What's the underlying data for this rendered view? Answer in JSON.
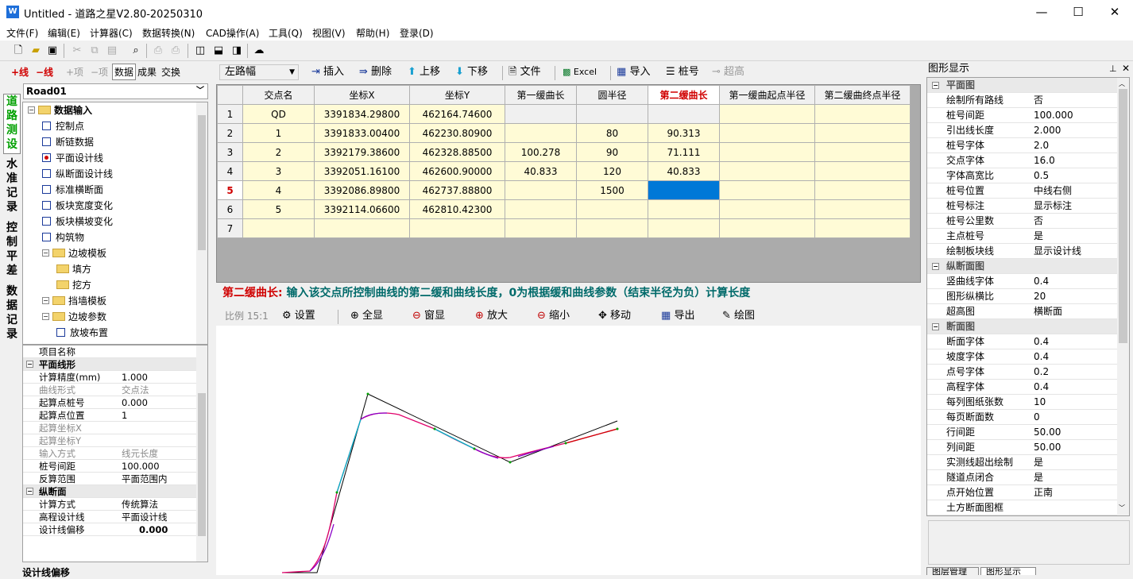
{
  "window": {
    "title": "Untitled - 道路之星V2.80-20250310",
    "icon": "app-icon",
    "minimize": "—",
    "maximize": "☐",
    "close": "✕"
  },
  "menu": [
    "文件(F)",
    "编辑(E)",
    "计算器(C)",
    "数据转换(N)",
    "CAD操作(A)",
    "工具(Q)",
    "视图(V)",
    "帮助(H)",
    "登录(D)"
  ],
  "left": {
    "buttons": {
      "add_line": "+线",
      "del_line": "−线",
      "add_item": "+项",
      "del_item": "−项",
      "data": "数据",
      "result": "成果",
      "exchange": "交换"
    },
    "road": "Road01",
    "vtabs": [
      "道路测设",
      "水准记录",
      "控制平差",
      "数据记录"
    ],
    "tree": [
      {
        "label": "数据输入",
        "kind": "folder",
        "level": 0
      },
      {
        "label": "控制点",
        "kind": "check",
        "level": 1
      },
      {
        "label": "断链数据",
        "kind": "check",
        "level": 1
      },
      {
        "label": "平面设计线",
        "kind": "checkon",
        "level": 1
      },
      {
        "label": "纵断面设计线",
        "kind": "check",
        "level": 1
      },
      {
        "label": "标准横断面",
        "kind": "check",
        "level": 1
      },
      {
        "label": "板块宽度变化",
        "kind": "check",
        "level": 1
      },
      {
        "label": "板块横坡变化",
        "kind": "check",
        "level": 1
      },
      {
        "label": "构筑物",
        "kind": "check",
        "level": 1
      },
      {
        "label": "边坡模板",
        "kind": "folder",
        "level": 1
      },
      {
        "label": "填方",
        "kind": "folder",
        "level": 2
      },
      {
        "label": "挖方",
        "kind": "folder",
        "level": 2
      },
      {
        "label": "挡墙模板",
        "kind": "folder",
        "level": 1
      },
      {
        "label": "边坡参数",
        "kind": "folder",
        "level": 1
      },
      {
        "label": "放坡布置",
        "kind": "check",
        "level": 2
      }
    ],
    "props": [
      {
        "k": "项目名称",
        "v": "",
        "t": "row"
      },
      {
        "k": "平面线形",
        "v": "",
        "t": "cat"
      },
      {
        "k": "计算精度(mm)",
        "v": "1.000",
        "t": "row"
      },
      {
        "k": "曲线形式",
        "v": "交点法",
        "t": "dis"
      },
      {
        "k": "起算点桩号",
        "v": "0.000",
        "t": "row"
      },
      {
        "k": "起算点位置",
        "v": "1",
        "t": "row"
      },
      {
        "k": "起算坐标X",
        "v": "",
        "t": "dis"
      },
      {
        "k": "起算坐标Y",
        "v": "",
        "t": "dis"
      },
      {
        "k": "输入方式",
        "v": "线元长度",
        "t": "dis"
      },
      {
        "k": "桩号间距",
        "v": "100.000",
        "t": "row"
      },
      {
        "k": "反算范围",
        "v": "平面范围内",
        "t": "row"
      },
      {
        "k": "纵断面",
        "v": "",
        "t": "cat"
      },
      {
        "k": "计算方式",
        "v": "传统算法",
        "t": "row"
      },
      {
        "k": "高程设计线",
        "v": "平面设计线",
        "t": "row"
      },
      {
        "k": "设计线偏移",
        "v": "0.000",
        "t": "bold"
      }
    ],
    "bottom_label": "设计线偏移"
  },
  "center": {
    "side_select": "左路幅",
    "toolbar": [
      "插入",
      "删除",
      "上移",
      "下移",
      "文件",
      "Excel",
      "导入",
      "桩号",
      "超高"
    ],
    "columns": [
      "交点名",
      "坐标X",
      "坐标Y",
      "第一缓曲长",
      "圆半径",
      "第二缓曲长",
      "第一缓曲起点半径",
      "第二缓曲终点半径"
    ],
    "rows": [
      {
        "n": "1",
        "cells": [
          "QD",
          "3391834.29800",
          "462164.74600",
          "",
          "",
          "",
          "",
          ""
        ]
      },
      {
        "n": "2",
        "cells": [
          "1",
          "3391833.00400",
          "462230.80900",
          "",
          "80",
          "90.313",
          "",
          ""
        ]
      },
      {
        "n": "3",
        "cells": [
          "2",
          "3392179.38600",
          "462328.88500",
          "100.278",
          "90",
          "71.111",
          "",
          ""
        ]
      },
      {
        "n": "4",
        "cells": [
          "3",
          "3392051.16100",
          "462600.90000",
          "40.833",
          "120",
          "40.833",
          "",
          ""
        ]
      },
      {
        "n": "5",
        "cells": [
          "4",
          "3392086.89800",
          "462737.88800",
          "",
          "1500",
          "",
          "",
          ""
        ]
      },
      {
        "n": "6",
        "cells": [
          "5",
          "3392114.06600",
          "462810.42300",
          "",
          "",
          "",
          "",
          ""
        ]
      },
      {
        "n": "7",
        "cells": [
          "",
          "",
          "",
          "",
          "",
          "",
          "",
          ""
        ]
      }
    ],
    "hint_key": "第二缓曲长:",
    "hint_text": " 输入该交点所控制曲线的第二缓和曲线长度，0为根据缓和曲线参数（结束半径为负）计算长度",
    "draw_toolbar": {
      "scale": "比例 15:1",
      "items": [
        "设置",
        "全显",
        "窗显",
        "放大",
        "缩小",
        "移动",
        "导出",
        "绘图"
      ]
    }
  },
  "right": {
    "title": "图形显示",
    "rows": [
      {
        "k": "平面图",
        "v": "",
        "t": "cat"
      },
      {
        "k": "绘制所有路线",
        "v": "否"
      },
      {
        "k": "桩号间距",
        "v": "100.000"
      },
      {
        "k": "引出线长度",
        "v": "2.000"
      },
      {
        "k": "桩号字体",
        "v": "2.0"
      },
      {
        "k": "交点字体",
        "v": "16.0"
      },
      {
        "k": "字体高宽比",
        "v": "0.5"
      },
      {
        "k": "桩号位置",
        "v": "中线右侧"
      },
      {
        "k": "桩号标注",
        "v": "显示标注"
      },
      {
        "k": "桩号公里数",
        "v": "否"
      },
      {
        "k": "主点桩号",
        "v": "是"
      },
      {
        "k": "绘制板块线",
        "v": "显示设计线"
      },
      {
        "k": "纵断面图",
        "v": "",
        "t": "cat"
      },
      {
        "k": "竖曲线字体",
        "v": "0.4"
      },
      {
        "k": "图形纵横比",
        "v": "20"
      },
      {
        "k": "超高图",
        "v": "横断面"
      },
      {
        "k": "断面图",
        "v": "",
        "t": "cat"
      },
      {
        "k": "断面字体",
        "v": "0.4"
      },
      {
        "k": "坡度字体",
        "v": "0.4"
      },
      {
        "k": "点号字体",
        "v": "0.2"
      },
      {
        "k": "高程字体",
        "v": "0.4"
      },
      {
        "k": "每列图纸张数",
        "v": "10"
      },
      {
        "k": "每页断面数",
        "v": "0"
      },
      {
        "k": "行间距",
        "v": "50.00"
      },
      {
        "k": "列间距",
        "v": "50.00"
      },
      {
        "k": "实测线超出绘制",
        "v": "是"
      },
      {
        "k": "隧道点闭合",
        "v": "是"
      },
      {
        "k": "点开始位置",
        "v": "正南"
      },
      {
        "k": "土方断面图框",
        "v": ""
      }
    ],
    "tabs": [
      "图层管理",
      "图形显示"
    ]
  }
}
